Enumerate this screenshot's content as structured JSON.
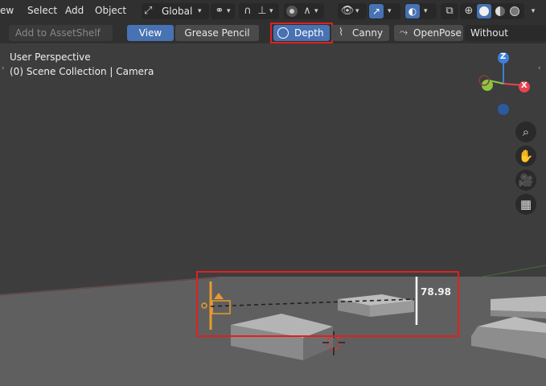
{
  "header": {
    "menu_view": "ew",
    "menu_select": "Select",
    "menu_add": "Add",
    "menu_object": "Object",
    "transform_orientation": "Global"
  },
  "toolbar": {
    "asset_shelf": "Add to AssetShelf",
    "view": "View",
    "grease_pencil": "Grease Pencil",
    "depth": "Depth",
    "canny": "Canny",
    "openpose": "OpenPose",
    "without_camera": "Without Camera"
  },
  "viewport": {
    "perspective": "User Perspective",
    "collection": "(0) Scene Collection | Camera",
    "measure_value": "78.98",
    "gizmo_z": "Z",
    "gizmo_x": "X"
  },
  "colors": {
    "accent": "#4772b3",
    "highlight_box": "#e02020",
    "camera_orange": "#e89a2c",
    "gizmo_x": "#e8434f",
    "gizmo_y": "#8cc63f",
    "gizmo_z": "#3d7fd9"
  }
}
